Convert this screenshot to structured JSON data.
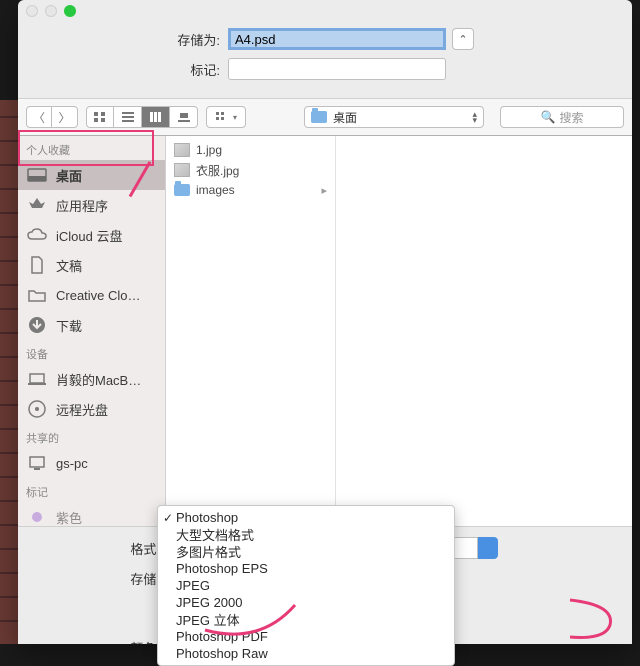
{
  "header": {
    "save_as_label": "存储为:",
    "filename": "A4.psd",
    "tag_label": "标记:"
  },
  "toolbar": {
    "location": "桌面",
    "search_placeholder": "搜索"
  },
  "sidebar": {
    "favorites_head": "个人收藏",
    "favorites": [
      {
        "label": "桌面"
      },
      {
        "label": "应用程序"
      },
      {
        "label": "iCloud 云盘"
      },
      {
        "label": "文稿"
      },
      {
        "label": "Creative Clo…"
      },
      {
        "label": "下载"
      }
    ],
    "devices_head": "设备",
    "devices": [
      {
        "label": "肖毅的MacB…"
      },
      {
        "label": "远程光盘"
      }
    ],
    "shared_head": "共享的",
    "shared": [
      {
        "label": "gs-pc"
      }
    ],
    "tags_head": "标记",
    "tags": [
      {
        "label": "紫色"
      }
    ]
  },
  "files": [
    {
      "name": "1.jpg",
      "type": "jpg"
    },
    {
      "name": "衣服.jpg",
      "type": "jpg"
    },
    {
      "name": "images",
      "type": "folder"
    }
  ],
  "bottom": {
    "format_label": "格式:",
    "save_label": "存储:",
    "color_label": "颜色:"
  },
  "format_menu": {
    "options": [
      "Photoshop",
      "大型文档格式",
      "多图片格式",
      "Photoshop EPS",
      "JPEG",
      "JPEG 2000",
      "JPEG 立体",
      "Photoshop PDF",
      "Photoshop Raw"
    ],
    "selected_index": 0
  }
}
